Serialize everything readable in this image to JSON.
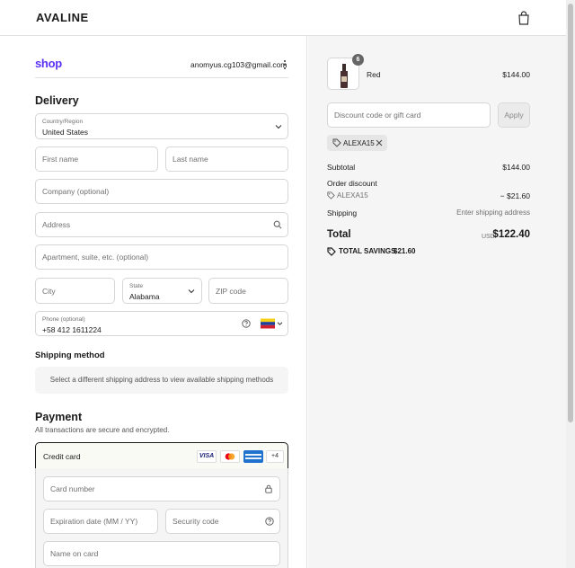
{
  "header": {
    "brand": "AVALINE",
    "cart_icon": "shopping-bag-icon"
  },
  "account": {
    "shop_logo": "shop",
    "email": "anomyus.cg103@gmail.com"
  },
  "delivery": {
    "title": "Delivery",
    "country_label": "Country/Region",
    "country_value": "United States",
    "first_name_placeholder": "First name",
    "last_name_placeholder": "Last name",
    "company_placeholder": "Company (optional)",
    "address_placeholder": "Address",
    "apartment_placeholder": "Apartment, suite, etc. (optional)",
    "city_placeholder": "City",
    "state_label": "State",
    "state_value": "Alabama",
    "zip_placeholder": "ZIP code",
    "phone_label": "Phone (optional)",
    "phone_value": "+58 412 1611224"
  },
  "shipping_method": {
    "title": "Shipping method",
    "notice": "Select a different shipping address to view available shipping methods"
  },
  "payment": {
    "title": "Payment",
    "subtitle": "All transactions are secure and encrypted.",
    "method_label": "Credit card",
    "more_cards": "+4",
    "card_number_placeholder": "Card number",
    "expiry_placeholder": "Expiration date (MM / YY)",
    "security_placeholder": "Security code",
    "name_placeholder": "Name on card"
  },
  "summary": {
    "item": {
      "name": "Red",
      "quantity": "6",
      "price": "$144.00"
    },
    "discount_placeholder": "Discount code or gift card",
    "apply_label": "Apply",
    "applied_code": "ALEXA15",
    "subtotal_label": "Subtotal",
    "subtotal_value": "$144.00",
    "order_discount_label": "Order discount",
    "discount_code": "ALEXA15",
    "discount_value": "− $21.60",
    "shipping_label": "Shipping",
    "shipping_value": "Enter shipping address",
    "total_label": "Total",
    "currency": "USD",
    "total_value": "$122.40",
    "savings_label": "TOTAL SAVINGS",
    "savings_value": "$21.60"
  }
}
